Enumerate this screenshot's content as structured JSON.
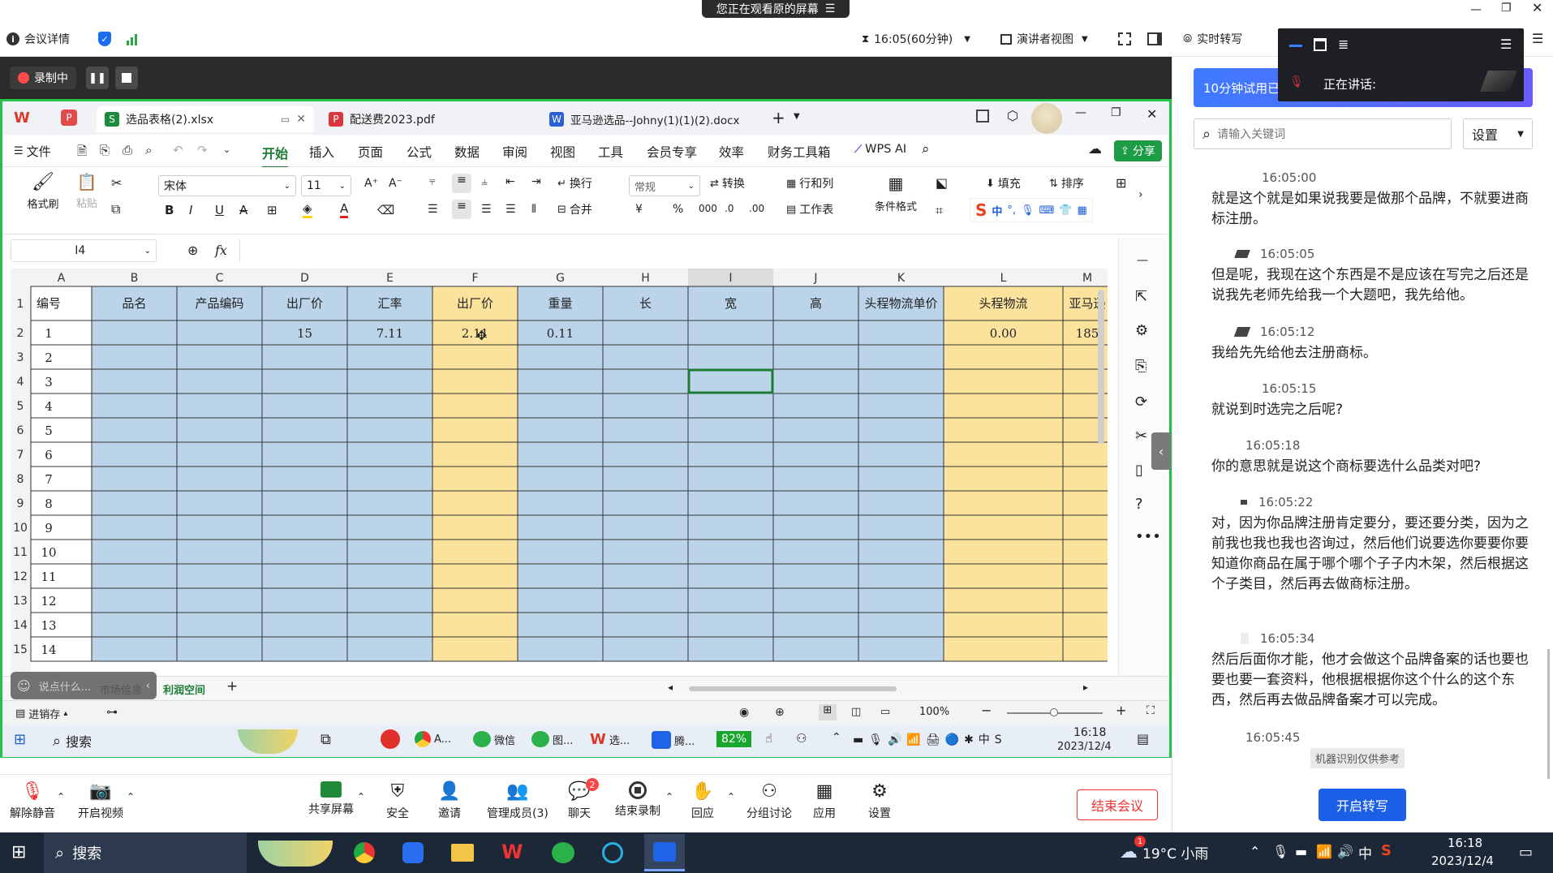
{
  "meeting_top": {
    "banner": "您正在观看原的屏幕",
    "meeting_info": "会议详情",
    "timer": "16:05(60分钟)",
    "view_mode": "演讲者视图",
    "realtime": "实时转写"
  },
  "speaking_popup": {
    "label": "正在讲话:"
  },
  "recording": {
    "label": "录制中"
  },
  "wps": {
    "tabs": [
      {
        "label": "选品表格(2).xlsx",
        "icon": "S"
      },
      {
        "label": "配送费2023.pdf",
        "icon": "P"
      },
      {
        "label": "亚马逊选品--Johny(1)(1)(2).docx",
        "icon": "W"
      }
    ],
    "menu": [
      "文件",
      "开始",
      "插入",
      "页面",
      "公式",
      "数据",
      "审阅",
      "视图",
      "工具",
      "会员专享",
      "效率",
      "财务工具箱"
    ],
    "menu_active": "开始",
    "wps_ai": "WPS AI",
    "share": "分享",
    "ribbon": {
      "format_painter": "格式刷",
      "paste": "粘贴",
      "font": "宋体",
      "size": "11",
      "wrap": "换行",
      "number_format": "常规",
      "convert": "转换",
      "rows_cols": "行和列",
      "worksheet": "工作表",
      "cond_format": "条件格式",
      "fill": "填充",
      "sort": "排序",
      "merge": "合并"
    },
    "name_box": "I4",
    "fx": "fx",
    "columns": [
      "A",
      "B",
      "C",
      "D",
      "E",
      "F",
      "G",
      "H",
      "I",
      "J",
      "K",
      "L",
      "M"
    ],
    "header_row": [
      "编号",
      "品名",
      "产品编码",
      "出厂价",
      "汇率",
      "出厂价",
      "重量",
      "长",
      "宽",
      "高",
      "头程物流单价",
      "头程物流",
      "亚马逊"
    ],
    "row2": [
      "1",
      "",
      "",
      "15",
      "7.11",
      "2.11",
      "0.11",
      "",
      "",
      "",
      "",
      "0.00",
      "185"
    ],
    "row_numbers": [
      "1",
      "2",
      "3",
      "4",
      "5",
      "6",
      "7",
      "8",
      "9",
      "10",
      "11",
      "12",
      "13",
      "14",
      "15"
    ],
    "id_values": [
      "2",
      "3",
      "4",
      "5",
      "6",
      "7",
      "8",
      "9",
      "10",
      "11",
      "12",
      "13",
      "14"
    ],
    "sheets": [
      "市场信息",
      "利润空间"
    ],
    "active_sheet": "利润空间",
    "chat_hint": "说点什么...",
    "status_left": "进销存",
    "zoom": "100%",
    "colors": {
      "blue": "#bcd4ea",
      "yellow": "#fbe39e",
      "green": "#1e7b34"
    }
  },
  "inner_taskbar": {
    "search": "搜索",
    "apps": [
      "A...",
      "微信",
      "图...",
      "选...",
      "腾..."
    ],
    "battery": "82%",
    "time": "16:18",
    "date": "2023/12/4"
  },
  "right_panel": {
    "trial": "10分钟试用已",
    "search_placeholder": "请输入关键词",
    "settings": "设置",
    "transcripts": [
      {
        "time": "16:05:00",
        "text": "就是这个就是如果说我要是做那个品牌，不就要进商标注册。"
      },
      {
        "time": "16:05:05",
        "text": "但是呢，我现在这个东西是不是应该在写完之后还是说我先老师先给我一个大题吧，我先给他。"
      },
      {
        "time": "16:05:12",
        "text": "我给先先给他去注册商标。"
      },
      {
        "time": "16:05:15",
        "text": "就说到时选完之后呢?"
      },
      {
        "time": "16:05:18",
        "text": "你的意思就是说这个商标要选什么品类对吧?"
      },
      {
        "time": "16:05:22",
        "text": "对，因为你品牌注册肯定要分，要还要分类，因为之前我也我也我也咨询过，然后他们说要选你要要你要知道你商品在属于哪个哪个子子内木架，然后根据这个子类目，然后再去做商标注册。"
      },
      {
        "time": "16:05:34",
        "text": "然后后面你才能，他才会做这个品牌备案的话也要也要也要一套资料，他根据根据你这个什么的这个东西，然后再去做品牌备案才可以完成。"
      },
      {
        "time": "16:05:45",
        "text": ""
      }
    ],
    "machine_note": "机器识别仅供参考",
    "start_btn": "开启转写"
  },
  "meeting_bottom": {
    "buttons": [
      "解除静音",
      "开启视频",
      "共享屏幕",
      "安全",
      "邀请",
      "管理成员(3)",
      "聊天",
      "结束录制",
      "回应",
      "分组讨论",
      "应用",
      "设置"
    ],
    "chat_badge": "2",
    "end": "结束会议"
  },
  "taskbar": {
    "search": "搜索",
    "weather": "19°C 小雨",
    "ime": "中",
    "time": "16:18",
    "date": "2023/12/4",
    "weather_badge": "1"
  }
}
